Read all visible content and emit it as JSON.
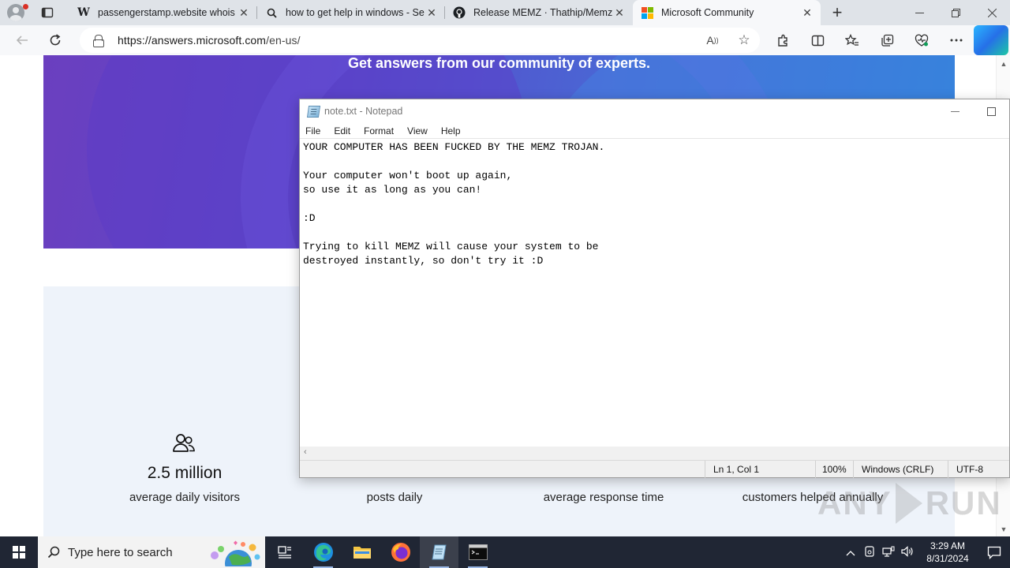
{
  "browser": {
    "tabs": [
      {
        "title": "passengerstamp.website whois lo",
        "favicon": "wikipedia-w-icon"
      },
      {
        "title": "how to get help in windows - Sea",
        "favicon": "search-icon"
      },
      {
        "title": "Release MEMZ · Thathip/Memz-D",
        "favicon": "github-icon"
      },
      {
        "title": "Microsoft Community",
        "favicon": "microsoft-logo-icon",
        "active": true
      }
    ],
    "close_glyph": "✕",
    "new_tab_glyph": "+",
    "url_scheme_host": "https://answers.microsoft.com",
    "url_path": "/en-us/"
  },
  "webpage": {
    "hero_text": "Get answers from our community of experts.",
    "stats": [
      {
        "value": "2.5 million",
        "label": "average daily visitors"
      },
      {
        "value": "",
        "label": "posts daily"
      },
      {
        "value": "",
        "label": "average response time"
      },
      {
        "value": "",
        "label": "customers helped annually"
      }
    ]
  },
  "notepad": {
    "title": "note.txt - Notepad",
    "menu": [
      "File",
      "Edit",
      "Format",
      "View",
      "Help"
    ],
    "content": "YOUR COMPUTER HAS BEEN FUCKED BY THE MEMZ TROJAN.\n\nYour computer won't boot up again,\nso use it as long as you can!\n\n:D\n\nTrying to kill MEMZ will cause your system to be\ndestroyed instantly, so don't try it :D",
    "status": {
      "position": "Ln 1, Col 1",
      "zoom": "100%",
      "line_ending": "Windows (CRLF)",
      "encoding": "UTF-8"
    }
  },
  "watermark": {
    "left": "ANY",
    "right": "RUN"
  },
  "taskbar": {
    "search_placeholder": "Type here to search",
    "time": "3:29 AM",
    "date": "8/31/2024"
  }
}
